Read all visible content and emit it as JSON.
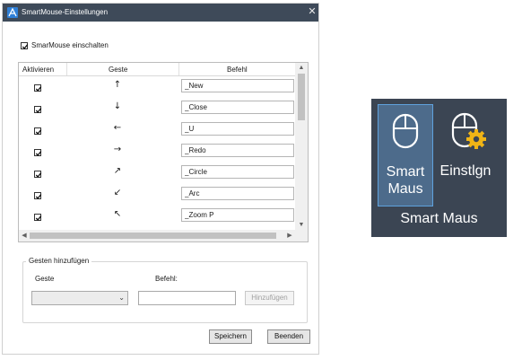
{
  "dialog": {
    "title": "SmartMouse-Einstellungen",
    "close_glyph": "✕",
    "enable_label": "SmarMouse einschalten",
    "enable_checked": true,
    "table": {
      "headers": [
        "Aktivieren",
        "Geste",
        "Befehl"
      ],
      "rows": [
        {
          "checked": true,
          "gesture_icon": "arrow-up-icon",
          "gesture": "↑",
          "command": "_New"
        },
        {
          "checked": true,
          "gesture_icon": "arrow-down-icon",
          "gesture": "↓",
          "command": "_Close"
        },
        {
          "checked": true,
          "gesture_icon": "arrow-left-icon",
          "gesture": "←",
          "command": "_U"
        },
        {
          "checked": true,
          "gesture_icon": "arrow-right-icon",
          "gesture": "→",
          "command": "_Redo"
        },
        {
          "checked": true,
          "gesture_icon": "arrow-up-right-icon",
          "gesture": "↗",
          "command": "_Circle"
        },
        {
          "checked": true,
          "gesture_icon": "arrow-down-left-icon",
          "gesture": "↙",
          "command": "_Arc"
        },
        {
          "checked": true,
          "gesture_icon": "arrow-up-left-icon",
          "gesture": "↖",
          "command": "_Zoom P"
        }
      ]
    },
    "add_group": {
      "title": "Gesten hinzufügen",
      "gesture_label": "Geste",
      "command_label": "Befehl:",
      "gesture_value": "",
      "command_value": "",
      "add_button": "Hinzufügen"
    },
    "save_button": "Speichern",
    "exit_button": "Beenden"
  },
  "ribbon": {
    "buttons": [
      {
        "label": "Smart\nMaus",
        "icon": "mouse-icon",
        "active": true
      },
      {
        "label": "Einstlgn",
        "icon": "mouse-settings-icon",
        "active": false
      }
    ],
    "panel_title": "Smart Maus"
  },
  "colors": {
    "titlebar": "#3e4a59",
    "ribbon_bg": "#3b4553",
    "ribbon_active": "#4d6b8b",
    "gear": "#f0b416"
  }
}
